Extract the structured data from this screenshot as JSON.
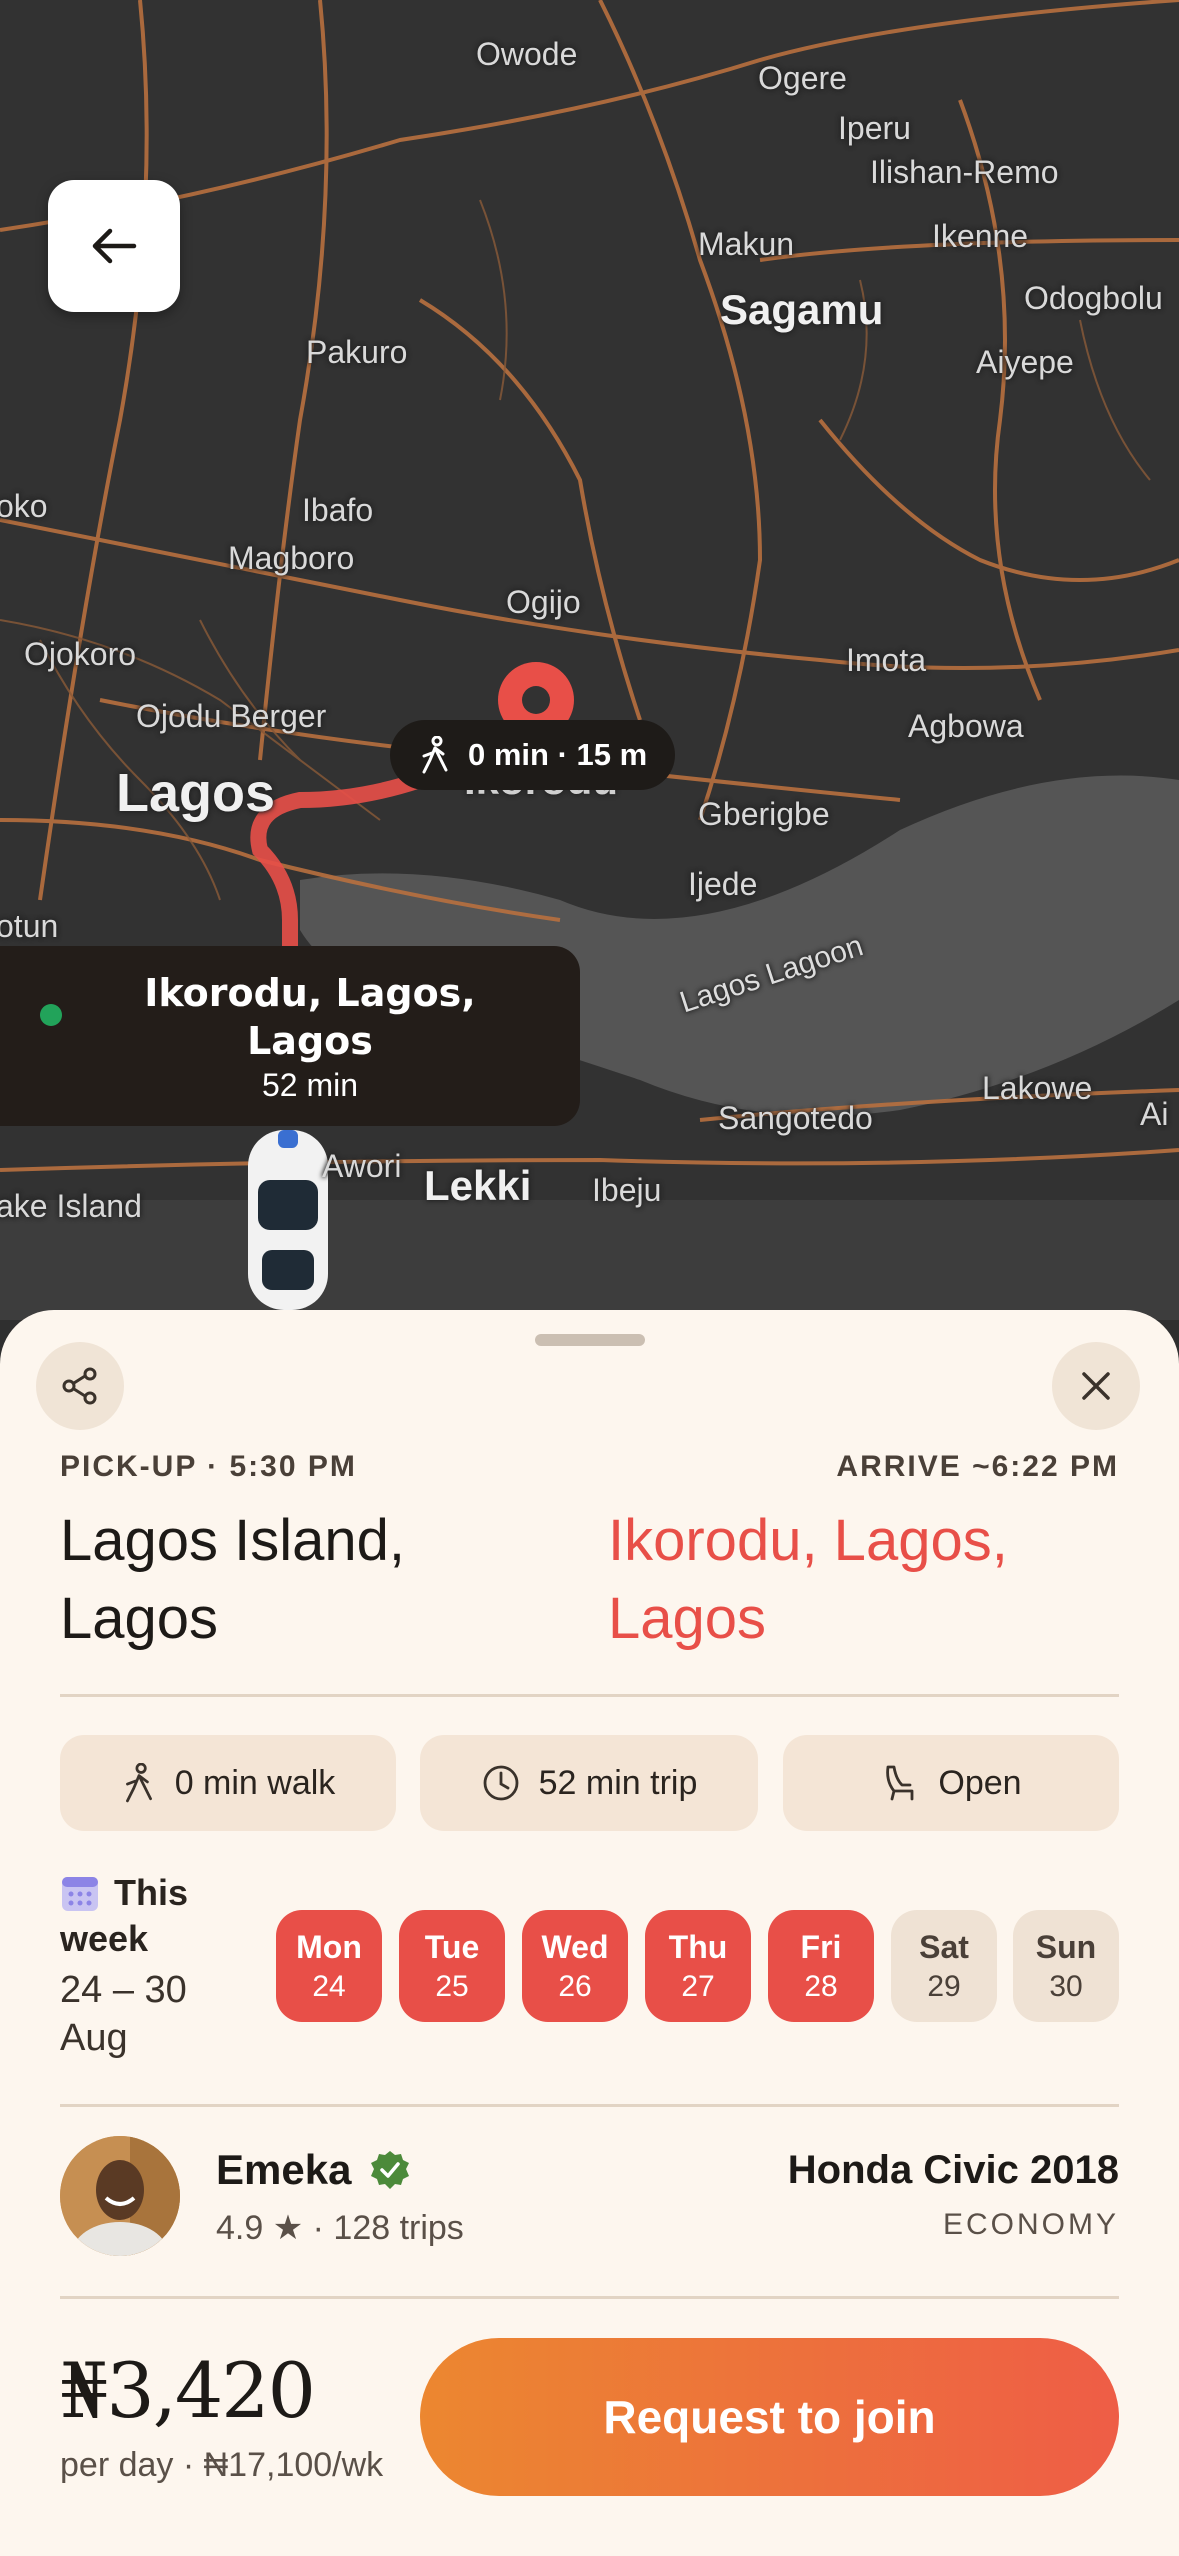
{
  "map": {
    "places": [
      {
        "id": "owode",
        "name": "Owode"
      },
      {
        "id": "ogere",
        "name": "Ogere"
      },
      {
        "id": "iperu",
        "name": "Iperu"
      },
      {
        "id": "ilishan",
        "name": "Ilishan-Remo"
      },
      {
        "id": "makun",
        "name": "Makun"
      },
      {
        "id": "ikenne",
        "name": "Ikenne"
      },
      {
        "id": "sagamu",
        "name": "Sagamu"
      },
      {
        "id": "odogbolu",
        "name": "Odogbolu"
      },
      {
        "id": "aiyepe",
        "name": "Aiyepe"
      },
      {
        "id": "pakuro",
        "name": "Pakuro"
      },
      {
        "id": "oko",
        "name": "oko"
      },
      {
        "id": "ibafo",
        "name": "Ibafo"
      },
      {
        "id": "magboro",
        "name": "Magboro"
      },
      {
        "id": "ogijo",
        "name": "Ogijo"
      },
      {
        "id": "ojokoro",
        "name": "Ojokoro"
      },
      {
        "id": "imota",
        "name": "Imota"
      },
      {
        "id": "ojodu",
        "name": "Ojodu Berger"
      },
      {
        "id": "agbowa",
        "name": "Agbowa"
      },
      {
        "id": "lagos",
        "name": "Lagos"
      },
      {
        "id": "ikorodu",
        "name": "Ikorodu"
      },
      {
        "id": "gberigbe",
        "name": "Gberigbe"
      },
      {
        "id": "ijede",
        "name": "Ijede"
      },
      {
        "id": "otun",
        "name": "otun"
      },
      {
        "id": "lagoon",
        "name": "Lagos Lagoon"
      },
      {
        "id": "lakowe",
        "name": "Lakowe"
      },
      {
        "id": "ai",
        "name": "Ai"
      },
      {
        "id": "sangotedo",
        "name": "Sangotedo"
      },
      {
        "id": "awori",
        "name": "Awori"
      },
      {
        "id": "lekki",
        "name": "Lekki"
      },
      {
        "id": "ibeju",
        "name": "Ibeju"
      },
      {
        "id": "lakeisland",
        "name": "ake Island"
      }
    ],
    "walk_pill": "0 min · 15 m",
    "destination_card": {
      "title": "Ikorodu, Lagos, Lagos",
      "duration": "52 min"
    }
  },
  "sheet": {
    "pickup_label": "PICK-UP · 5:30 PM",
    "arrive_label": "ARRIVE ~6:22 PM",
    "pickup_city": "Lagos Island, Lagos",
    "arrive_city": "Ikorodu, Lagos, Lagos",
    "chips": [
      {
        "icon": "walk-icon",
        "label": "0 min walk"
      },
      {
        "icon": "clock-icon",
        "label": "52 min trip"
      },
      {
        "icon": "seat-icon",
        "label": "Open"
      }
    ],
    "week": {
      "title1": "This",
      "title2": "week",
      "range": "24 – 30 Aug"
    },
    "days": [
      {
        "name": "Mon",
        "date": "24",
        "selected": true
      },
      {
        "name": "Tue",
        "date": "25",
        "selected": true
      },
      {
        "name": "Wed",
        "date": "26",
        "selected": true
      },
      {
        "name": "Thu",
        "date": "27",
        "selected": true
      },
      {
        "name": "Fri",
        "date": "28",
        "selected": true
      },
      {
        "name": "Sat",
        "date": "29",
        "selected": false
      },
      {
        "name": "Sun",
        "date": "30",
        "selected": false
      }
    ],
    "driver": {
      "name": "Emeka",
      "meta": "4.9 ★ · 128 trips"
    },
    "car": {
      "name": "Honda Civic 2018",
      "class": "ECONOMY"
    },
    "price": {
      "amount": "₦3,420",
      "sub": "per day · ₦17,100/wk"
    },
    "cta_label": "Request to join"
  },
  "colors": {
    "accent_red": "#e84f48",
    "cta_start": "#ec8730",
    "cta_end": "#ee5d46",
    "sheet_bg": "#fdf6ee",
    "map_bg": "#323232"
  }
}
